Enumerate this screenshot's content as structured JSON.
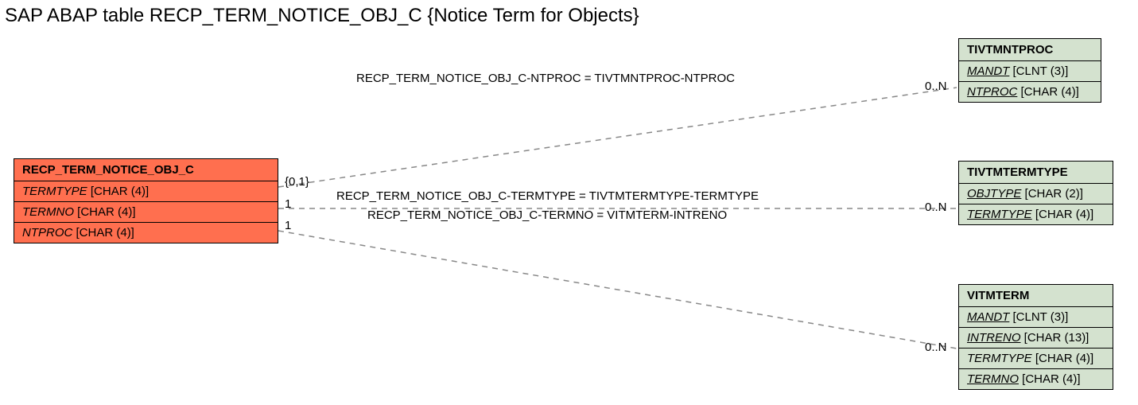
{
  "title": "SAP ABAP table RECP_TERM_NOTICE_OBJ_C {Notice Term for Objects}",
  "entities": {
    "main": {
      "name": "RECP_TERM_NOTICE_OBJ_C",
      "fields": [
        {
          "label": "TERMTYPE",
          "type": "[CHAR (4)]",
          "style": "ki"
        },
        {
          "label": "TERMNO",
          "type": "[CHAR (4)]",
          "style": "ki"
        },
        {
          "label": "NTPROC",
          "type": "[CHAR (4)]",
          "style": "ki"
        }
      ]
    },
    "t1": {
      "name": "TIVTMNTPROC",
      "fields": [
        {
          "label": "MANDT",
          "type": "[CLNT (3)]",
          "style": "k"
        },
        {
          "label": "NTPROC",
          "type": "[CHAR (4)]",
          "style": "k"
        }
      ]
    },
    "t2": {
      "name": "TIVTMTERMTYPE",
      "fields": [
        {
          "label": "OBJTYPE",
          "type": "[CHAR (2)]",
          "style": "k"
        },
        {
          "label": "TERMTYPE",
          "type": "[CHAR (4)]",
          "style": "k"
        }
      ]
    },
    "t3": {
      "name": "VITMTERM",
      "fields": [
        {
          "label": "MANDT",
          "type": "[CLNT (3)]",
          "style": "k"
        },
        {
          "label": "INTRENO",
          "type": "[CHAR (13)]",
          "style": "k"
        },
        {
          "label": "TERMTYPE",
          "type": "[CHAR (4)]",
          "style": "ki"
        },
        {
          "label": "TERMNO",
          "type": "[CHAR (4)]",
          "style": "k"
        }
      ]
    }
  },
  "relations": {
    "r1": {
      "text": "RECP_TERM_NOTICE_OBJ_C-NTPROC = TIVTMNTPROC-NTPROC",
      "left_card": "{0,1}",
      "right_card": "0..N"
    },
    "r2": {
      "text": "RECP_TERM_NOTICE_OBJ_C-TERMTYPE = TIVTMTERMTYPE-TERMTYPE",
      "left_card": "1",
      "right_card": "0..N"
    },
    "r3": {
      "text": "RECP_TERM_NOTICE_OBJ_C-TERMNO = VITMTERM-INTRENO",
      "left_card": "1",
      "right_card": "0..N"
    }
  }
}
